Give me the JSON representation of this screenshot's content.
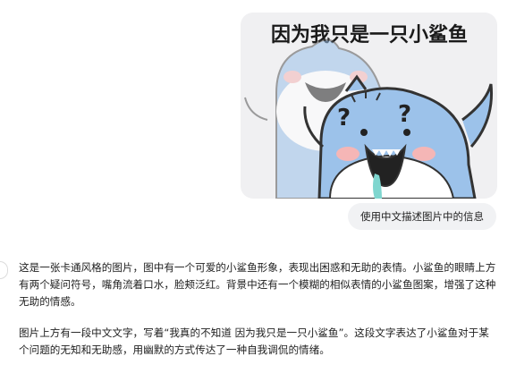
{
  "image": {
    "caption_in_image": "因为我只是一只小鲨鱼",
    "icon": "shark-meme-image"
  },
  "user_message": "使用中文描述图片中的信息",
  "response": {
    "paragraphs": [
      "这是一张卡通风格的图片，图中有一个可爱的小鲨鱼形象，表现出困惑和无助的表情。小鲨鱼的眼睛上方有两个疑问符号，嘴角流着口水，脸颊泛红。背景中还有一个模糊的相似表情的小鲨鱼图案，增强了这种无助的情感。",
      "图片上方有一段中文文字，写着“我真的不知道 因为我只是一只小鲨鱼”。这段文字表达了小鲨鱼对于某个问题的无知和无助感，用幽默的方式传达了一种自我调侃的情绪。"
    ]
  },
  "colors": {
    "shark_blue": "#9cc2ea",
    "blush": "#f5b6b6",
    "drool": "#7fd6cf"
  }
}
